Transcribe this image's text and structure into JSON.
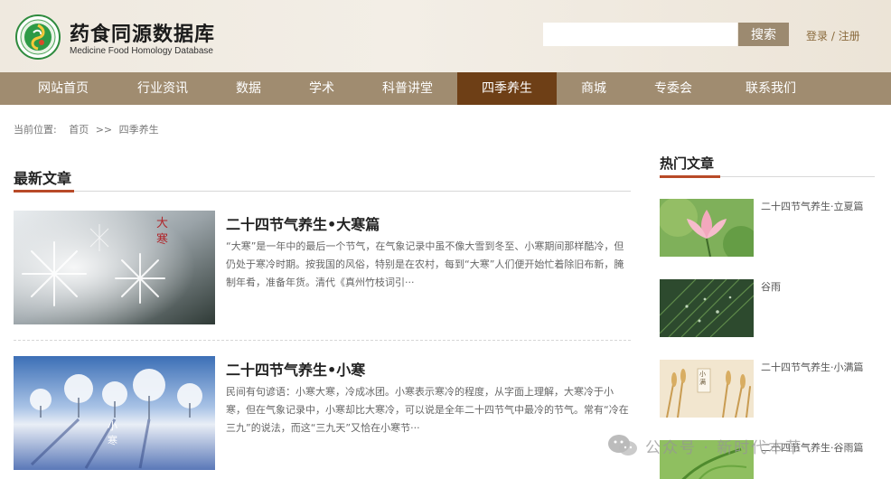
{
  "header": {
    "site_title": "药食同源数据库",
    "site_subtitle": "Medicine Food Homology Database",
    "search_placeholder": "",
    "search_button": "搜索",
    "login": "登录",
    "separator": " / ",
    "register": "注册"
  },
  "nav": {
    "items": [
      {
        "label": "网站首页"
      },
      {
        "label": "行业资讯"
      },
      {
        "label": "数据"
      },
      {
        "label": "学术"
      },
      {
        "label": "科普讲堂"
      },
      {
        "label": "四季养生",
        "active": true
      },
      {
        "label": "商城"
      },
      {
        "label": "专委会"
      },
      {
        "label": "联系我们"
      }
    ]
  },
  "breadcrumb": {
    "prefix": "当前位置:",
    "home": "首页",
    "sep": ">>",
    "current": "四季养生"
  },
  "latest": {
    "heading": "最新文章",
    "articles": [
      {
        "title": "二十四节气养生•大寒篇",
        "summary": "“大寒”是一年中的最后一个节气，在气象记录中虽不像大雪到冬至、小寒期间那样酷冷，但仍处于寒冷时期。按我国的风俗，特别是在农村，每到“大寒”人们便开始忙着除旧布新，腌制年肴，准备年货。清代《真州竹枝词引···",
        "thumb_caption": "大寒"
      },
      {
        "title": "二十四节气养生•小寒",
        "summary": "民间有句谚语：小寒大寒，冷成冰团。小寒表示寒冷的程度，从字面上理解，大寒冷于小寒，但在气象记录中，小寒却比大寒冷，可以说是全年二十四节气中最冷的节气。常有“冷在三九”的说法，而这“三九天”又恰在小寒节···",
        "thumb_caption": "小寒"
      }
    ]
  },
  "hot": {
    "heading": "热门文章",
    "items": [
      {
        "label": "二十四节气养生·立夏篇"
      },
      {
        "label": "谷雨"
      },
      {
        "label": "二十四节气养生·小满篇"
      },
      {
        "label": "二十四节气养生·谷雨篇"
      }
    ],
    "xiaoman_thumb_caption": "小满"
  },
  "watermark": {
    "text": "公众号 · 新时代本草"
  },
  "colors": {
    "nav_bg": "#a08c70",
    "nav_active": "#6e3f16",
    "accent": "#b84a28",
    "search_button": "#9c8a70"
  }
}
